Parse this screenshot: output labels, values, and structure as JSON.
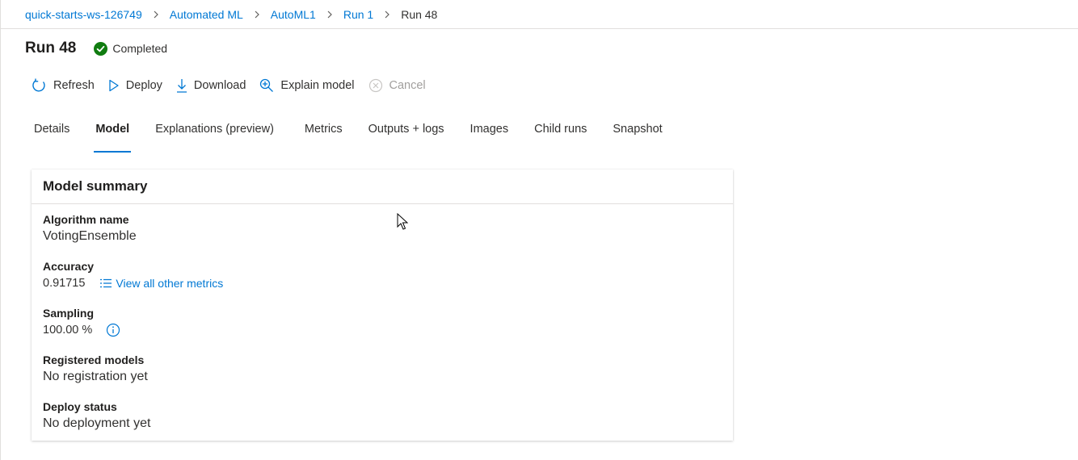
{
  "breadcrumb": {
    "items": [
      "quick-starts-ws-126749",
      "Automated ML",
      "AutoML1",
      "Run 1"
    ],
    "current": "Run 48"
  },
  "header": {
    "title": "Run 48",
    "status": "Completed",
    "status_color": "#107c10"
  },
  "toolbar": {
    "refresh": "Refresh",
    "deploy": "Deploy",
    "download": "Download",
    "explain": "Explain model",
    "cancel": "Cancel"
  },
  "tabs": [
    "Details",
    "Model",
    "Explanations (preview)",
    "Metrics",
    "Outputs + logs",
    "Images",
    "Child runs",
    "Snapshot"
  ],
  "active_tab": "Model",
  "summary": {
    "title": "Model summary",
    "algorithm_label": "Algorithm name",
    "algorithm_value": "VotingEnsemble",
    "accuracy_label": "Accuracy",
    "accuracy_value": "0.91715",
    "metrics_link": "View all other metrics",
    "sampling_label": "Sampling",
    "sampling_value": "100.00 %",
    "registered_label": "Registered models",
    "registered_value": "No registration yet",
    "deploy_label": "Deploy status",
    "deploy_value": "No deployment yet"
  },
  "colors": {
    "accent": "#0078d4",
    "text": "#323130",
    "disabled": "#a19f9d"
  }
}
